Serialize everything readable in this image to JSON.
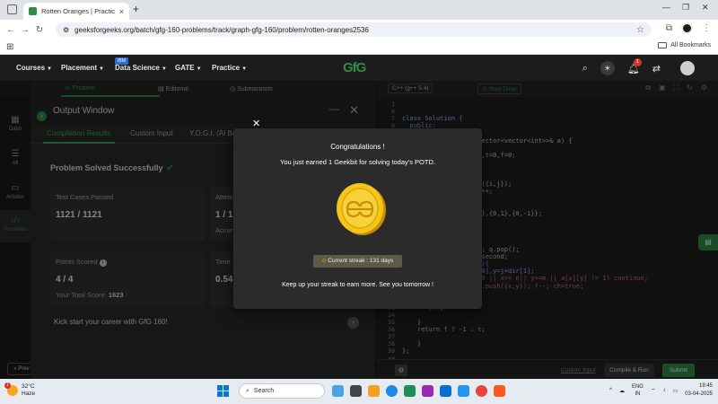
{
  "browser": {
    "tab_title": "Rotten Oranges | Practice | Gee",
    "url": "geeksforgeeks.org/batch/gfg-160-problems/track/graph-gfg-160/problem/rotten-oranges2536",
    "all_bookmarks": "All Bookmarks"
  },
  "gfg_nav": {
    "items": [
      "Courses",
      "Placement",
      "Data Science",
      "GATE",
      "Practice"
    ],
    "ibm_badge": "IBM",
    "logo": "GfG",
    "notification_count": "1"
  },
  "left_tabs": [
    "Problem",
    "Editorial",
    "Submissions"
  ],
  "sidebar": {
    "items": [
      "Dash",
      "All",
      "Articles",
      "Problems"
    ],
    "prev": "Prev"
  },
  "output_window": {
    "title": "Output Window",
    "tabs": [
      "Compilation Results",
      "Custom Input",
      "Y.O.G.I. (AI Bot)"
    ],
    "status": "Problem Solved Successfully",
    "cards": {
      "test_cases_label": "Test Cases Passed",
      "test_cases_value": "1121 / 1121",
      "attempts_label": "Attem",
      "attempts_value": "1 / 1",
      "accuracy_label": "Accur",
      "points_label": "Points Scored",
      "points_value": "4 / 4",
      "total_score_label": "Your Total Score:",
      "total_score_value": "1623",
      "time_label": "Time",
      "time_value": "0.54"
    },
    "kickstart": "Kick start your career with GfG 160!"
  },
  "editor": {
    "language": "C++ (g++ 5.4)",
    "start_timer": "Start Timer",
    "line_numbers": [
      "1",
      "6",
      "7",
      "8",
      "9",
      "10",
      "11",
      "12",
      "13",
      "14",
      "15",
      "16",
      "17",
      "18",
      "19",
      "20",
      "21",
      "22",
      "23",
      "24",
      "25",
      "26",
      "27",
      "28",
      "29",
      "30",
      "31",
      "32",
      "33",
      "34",
      "35",
      "36",
      "37",
      "38",
      "39",
      "40"
    ],
    "code_lines": [
      "",
      "",
      "class Solution {",
      "  public:",
      "",
      "                   (vector<vector<int>>& a) {",
      "",
      "       ,m=a[0].size(),t=0,f=0;",
      "       ,int>> q;",
      "       n;i++){",
      "       ;j<m;j++)",
      "       [j]==2) q.push({i,j});",
      "       (a[i][j]==1) f++;",
      "",
      "       urn 0;",
      "       ]={{1,0},{-1,0},{0,1},{0,-1}};",
      "       mpty()){",
      "       =q.size();",
      "       r=false;",
      "       sz--){",
      "       to p=q.front(); q.pop();",
      "       i=p.first,j=p.second;",
      "       (auto &dir : d){",
      "         int x=i+dir[0],y=j+dir[1];",
      "         if(x<0 || y<0 || x>= n|| y>=m || a[x][y] != 1) continue;",
      "         a[x][y]=2; q.push({x,y}); f--; ch=true;",
      "",
      "",
      "       t++;",
      "",
      "    }",
      "    return f ? -1 : t;",
      "",
      "    }",
      "};",
      ""
    ],
    "custom_input": "Custom Input",
    "compile_run": "Compile & Run",
    "submit": "Submit"
  },
  "modal": {
    "title": "Congratulations !",
    "message": "You just earned 1 Geekbit for solving today's POTD.",
    "streak": "Current streak : 131 days",
    "footer": "Keep up your streak to earn more. See you tomorrow !"
  },
  "taskbar": {
    "temperature": "32°C",
    "weather": "Haze",
    "weather_badge": "1",
    "search": "Search",
    "lang_line1": "ENG",
    "lang_line2": "IN",
    "time": "19:45",
    "date": "03-04-2025"
  },
  "colors": {
    "accent": "#2f8d46",
    "editor_bg": "#1f1f1f",
    "modal_bg": "#2b2b2b",
    "coin": "#f5c518"
  }
}
